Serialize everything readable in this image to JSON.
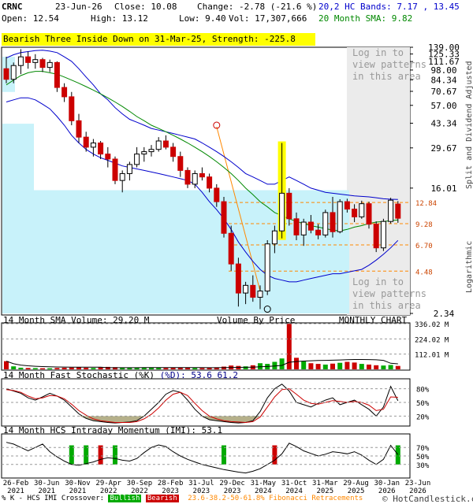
{
  "header": {
    "symbol": "CRNC",
    "date": "23-Jun-26",
    "close": "Close: 10.08",
    "change": "Change: -2.78 (-21.6 %)",
    "open": "Open: 12.54",
    "high": "High: 13.12",
    "low": "Low: 9.40",
    "vol": "Vol: 17,307,666",
    "bands": "20,2 HC Bands: 7.17 , 13.45",
    "sma": "20 Month SMA: 9.82"
  },
  "banner": "Bearish Three Inside Down on 31-Mar-25, Strength: -225.8",
  "login_note": "Log in to\nview patterns\nin this area",
  "side_labels": {
    "adjusted": "Split and Dividend Adjusted",
    "log": "Logarithmic"
  },
  "colors": {
    "up": "#00aa00",
    "down": "#cc0000",
    "band": "#0000cc",
    "sma": "#008800",
    "vbp": "#c8f2fa",
    "fib": "#ff8800",
    "banner": "#ffff00",
    "candle": "#ffff00"
  },
  "chart_data": [
    {
      "type": "candlestick",
      "title": "MONTHLY CHART",
      "scale": "log",
      "ylim": [
        2.34,
        139.0
      ],
      "y_ticks": [
        "139.00",
        "125.33",
        "111.67",
        "98.00",
        "84.34",
        "70.67",
        "57.00",
        "43.34",
        "29.67",
        "16.01",
        "2.34"
      ],
      "right_labels": [
        "12.84",
        "9.28",
        "6.70",
        "4.48"
      ],
      "x_labels": [
        "26-Feb\n2021",
        "30-Jun\n2021",
        "30-Nov\n2021",
        "29-Apr\n2022",
        "30-Sep\n2022",
        "28-Feb\n2023",
        "31-Jul\n2023",
        "29-Dec\n2023",
        "31-May\n2024",
        "31-Oct\n2024",
        "31-Mar\n2025",
        "29-Aug\n2025",
        "30-Jan\n2026",
        "23-Jun\n2026"
      ],
      "volume_by_price_label": "Volume By Price",
      "candles": [
        [
          100,
          120,
          80,
          85
        ],
        [
          85,
          110,
          80,
          105
        ],
        [
          105,
          135,
          92,
          120
        ],
        [
          120,
          130,
          100,
          110
        ],
        [
          110,
          125,
          100,
          115
        ],
        [
          115,
          118,
          95,
          102
        ],
        [
          102,
          115,
          95,
          110
        ],
        [
          110,
          112,
          70,
          75
        ],
        [
          75,
          80,
          60,
          65
        ],
        [
          65,
          70,
          42,
          45
        ],
        [
          45,
          50,
          32,
          35
        ],
        [
          35,
          38,
          28,
          30
        ],
        [
          30,
          34,
          26,
          32
        ],
        [
          32,
          33,
          25,
          27
        ],
        [
          27,
          30,
          22,
          25
        ],
        [
          25,
          26,
          17,
          18
        ],
        [
          18,
          21,
          15,
          20
        ],
        [
          20,
          24,
          18,
          23
        ],
        [
          23,
          30,
          22,
          27
        ],
        [
          27,
          30,
          24,
          28
        ],
        [
          28,
          31,
          26,
          29
        ],
        [
          29,
          35,
          28,
          33
        ],
        [
          33,
          36,
          29,
          30
        ],
        [
          30,
          32,
          24,
          26
        ],
        [
          26,
          28,
          19,
          21
        ],
        [
          21,
          22,
          16,
          17
        ],
        [
          17,
          21,
          16,
          20
        ],
        [
          20,
          22,
          18,
          19
        ],
        [
          19,
          20,
          15,
          16
        ],
        [
          16,
          17,
          12,
          13
        ],
        [
          13,
          14,
          7.5,
          8
        ],
        [
          8,
          9,
          4.5,
          5
        ],
        [
          5,
          5.5,
          2.6,
          3.2
        ],
        [
          3.2,
          3.8,
          2.7,
          3.6
        ],
        [
          3.6,
          4.2,
          2.8,
          3.0
        ],
        [
          3.0,
          3.6,
          2.5,
          3.3
        ],
        [
          3.3,
          7.2,
          3.1,
          6.8
        ],
        [
          6.8,
          9.0,
          5.9,
          8.3
        ],
        [
          8.3,
          32,
          7.4,
          14.8
        ],
        [
          14.8,
          16,
          9.0,
          10.0
        ],
        [
          10.0,
          11,
          7.2,
          7.8
        ],
        [
          7.8,
          10,
          6.6,
          9.5
        ],
        [
          9.5,
          10.6,
          8.0,
          8.4
        ],
        [
          8.4,
          9.2,
          7.3,
          7.8
        ],
        [
          7.8,
          11.5,
          7.5,
          11.0
        ],
        [
          11.0,
          14,
          7.5,
          8.2
        ],
        [
          8.2,
          13.5,
          8.0,
          13.0
        ],
        [
          13.0,
          13.6,
          11,
          11.6
        ],
        [
          11.6,
          12.5,
          9.5,
          10.3
        ],
        [
          10.3,
          13.2,
          10,
          12.6
        ],
        [
          12.6,
          13.0,
          8.6,
          9.2
        ],
        [
          9.2,
          9.6,
          6.0,
          6.4
        ],
        [
          6.4,
          10,
          6.1,
          9.6
        ],
        [
          9.6,
          13.8,
          9.3,
          13.3
        ],
        [
          12.54,
          13.12,
          9.4,
          10.08
        ]
      ],
      "bands": {
        "upper": [
          118,
          124,
          128,
          130,
          132,
          133,
          131,
          128,
          120,
          112,
          100,
          88,
          78,
          68,
          62,
          55,
          50,
          46,
          44,
          42,
          40,
          39,
          38,
          37,
          36,
          35,
          34,
          32,
          30,
          28,
          26,
          24,
          22,
          20,
          19,
          18,
          17,
          17,
          18,
          19,
          18,
          17,
          16,
          15.5,
          15,
          14.8,
          14.6,
          14.4,
          14.2,
          14.1,
          14.0,
          13.8,
          13.6,
          13.5,
          13.45
        ],
        "sma": [
          78,
          84,
          90,
          94,
          96,
          96,
          94,
          92,
          88,
          84,
          80,
          76,
          72,
          68,
          64,
          60,
          56,
          52,
          48,
          45,
          42,
          40,
          38,
          36,
          34,
          32,
          30,
          28,
          26,
          24,
          22,
          20,
          18,
          16,
          14.5,
          13,
          12,
          11,
          10.5,
          10,
          9.6,
          9.3,
          9.0,
          8.8,
          8.6,
          8.4,
          8.3,
          8.5,
          8.8,
          9.0,
          9.3,
          9.5,
          9.6,
          9.7,
          9.82
        ],
        "lower": [
          60,
          62,
          64,
          64,
          62,
          58,
          54,
          48,
          42,
          36,
          32,
          29,
          27,
          25.5,
          24.5,
          23.5,
          22.5,
          22,
          21.5,
          21,
          20.5,
          20,
          19.5,
          19,
          18.5,
          18,
          17,
          15,
          13,
          11.5,
          10,
          8.5,
          7,
          6,
          5.2,
          4.6,
          4.2,
          4.0,
          3.9,
          3.8,
          3.8,
          3.9,
          4.0,
          4.1,
          4.2,
          4.3,
          4.3,
          4.4,
          4.5,
          4.6,
          4.9,
          5.3,
          5.8,
          6.4,
          7.17
        ]
      },
      "fib_line": [
        [
          29,
          41
        ],
        [
          35,
          3.3
        ]
      ],
      "markers": [
        {
          "i": 29,
          "v": 42,
          "color": "#cc0000"
        },
        {
          "i": 36,
          "v": 2.5,
          "color": "#000000"
        }
      ]
    },
    {
      "type": "bar",
      "title": "14 Month SMA Volume: 29.20 M",
      "ylim": [
        0,
        336
      ],
      "y_ticks": [
        "336.02 M",
        "224.02 M",
        "112.01 M"
      ],
      "values": [
        60,
        22,
        12,
        10,
        9,
        8,
        8,
        10,
        12,
        13,
        15,
        12,
        10,
        14,
        18,
        16,
        13,
        12,
        12,
        14,
        13,
        12,
        10,
        11,
        14,
        12,
        10,
        9,
        12,
        15,
        20,
        28,
        25,
        22,
        30,
        45,
        40,
        55,
        80,
        335,
        85,
        60,
        45,
        40,
        35,
        42,
        48,
        55,
        50,
        40,
        35,
        30,
        28,
        32,
        25
      ]
    },
    {
      "type": "line",
      "title": "14 Month Fast Stochastic (%K)",
      "title_suffix": "(%D): 53.6  61.2",
      "ylim": [
        0,
        100
      ],
      "y_ticks": [
        "80%",
        "50%",
        "20%"
      ],
      "k": [
        80,
        75,
        70,
        60,
        55,
        62,
        70,
        64,
        55,
        40,
        25,
        15,
        10,
        8,
        6,
        5,
        6,
        7,
        10,
        20,
        35,
        50,
        68,
        76,
        72,
        55,
        35,
        20,
        12,
        10,
        8,
        6,
        5,
        6,
        10,
        30,
        60,
        80,
        90,
        75,
        50,
        45,
        40,
        48,
        55,
        60,
        45,
        50,
        55,
        45,
        35,
        20,
        40,
        85,
        53.6
      ],
      "d": [
        78,
        76,
        72,
        64,
        58,
        60,
        65,
        64,
        58,
        46,
        32,
        22,
        14,
        10,
        8,
        6,
        6,
        6,
        8,
        14,
        24,
        38,
        55,
        68,
        72,
        65,
        48,
        32,
        20,
        14,
        10,
        8,
        7,
        6,
        8,
        18,
        40,
        62,
        78,
        80,
        68,
        55,
        48,
        46,
        50,
        54,
        52,
        50,
        52,
        50,
        44,
        32,
        35,
        62,
        61.2
      ]
    },
    {
      "type": "line",
      "title": "14 Month HCS Intraday Momentum (IMI): 53.1",
      "ylim": [
        0,
        100
      ],
      "y_ticks": [
        "70%",
        "50%",
        "30%"
      ],
      "imi": [
        82,
        78,
        70,
        62,
        70,
        78,
        60,
        48,
        38,
        30,
        28,
        32,
        36,
        42,
        46,
        44,
        40,
        38,
        44,
        58,
        70,
        76,
        72,
        60,
        50,
        42,
        36,
        30,
        26,
        22,
        18,
        15,
        12,
        10,
        14,
        20,
        30,
        40,
        55,
        80,
        72,
        62,
        56,
        50,
        54,
        60,
        58,
        55,
        60,
        52,
        40,
        30,
        42,
        75,
        53.1
      ],
      "crossovers": [
        {
          "i": 9,
          "type": "bullish"
        },
        {
          "i": 11,
          "type": "bullish"
        },
        {
          "i": 13,
          "type": "bearish"
        },
        {
          "i": 15,
          "type": "bullish"
        },
        {
          "i": 30,
          "type": "bullish"
        },
        {
          "i": 37,
          "type": "bearish"
        },
        {
          "i": 77,
          "type": "bullish"
        }
      ]
    }
  ],
  "footer": {
    "legend": "% K - HCS IMI Crossover:",
    "bullish": "Bullish",
    "bearish": "Bearish",
    "fib": "23.6-38.2-50-61.8% Fibonacci Retracements",
    "copyright": "© HotCandlestick.com"
  }
}
